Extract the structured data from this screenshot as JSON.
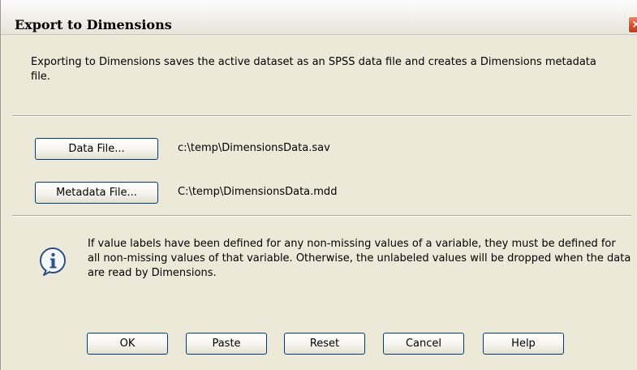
{
  "window": {
    "title": "Export to Dimensions",
    "close_glyph": "×",
    "close_icon": "close-icon"
  },
  "intro_text": "Exporting to Dimensions saves the active dataset as an SPSS data file and creates a Dimensions metadata file.",
  "files": {
    "data_button_label": "Data File...",
    "data_path": "c:\\temp\\DimensionsData.sav",
    "metadata_button_label": "Metadata File...",
    "metadata_path": "C:\\temp\\DimensionsData.mdd"
  },
  "info": {
    "icon": "info-icon",
    "text": "If value labels have been defined for any non-missing values of a variable, they must be defined for all non-missing values of that variable. Otherwise, the unlabeled values will be dropped when the data are read by Dimensions."
  },
  "buttons": {
    "ok": "OK",
    "paste": "Paste",
    "reset": "Reset",
    "cancel": "Cancel",
    "help": "Help"
  },
  "colors": {
    "dialog_bg": "#ece9d8",
    "button_border": "#003c74",
    "close_red": "#d4502d",
    "info_blue": "#2b4f8a"
  }
}
